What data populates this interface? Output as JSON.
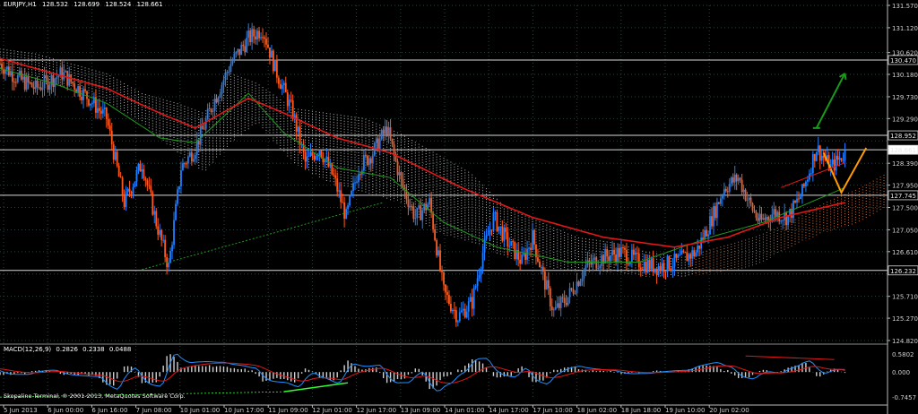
{
  "header": {
    "symbol": "EURJPY,H1",
    "open": "128.532",
    "high": "128.699",
    "low": "128.524",
    "close": "128.661"
  },
  "macd_header": {
    "name": "MACD(12,26,9)",
    "main": "0.2826",
    "signal": "0.2338",
    "histogram": "0.0488"
  },
  "copyright": "Skopalino Terminal, © 2001-2013, MetaQuotes Software Corp.",
  "colors": {
    "background": "#000000",
    "grid": "#2f3f3f",
    "bull": "#1e7fff",
    "bear": "#ff5a1e",
    "ma_red": "#e01818",
    "ma_green": "#1f9a1f",
    "cloud_bear": "#e8e8e8",
    "cloud_bull": "#ff9050",
    "orange_arrow": "#ff9a00",
    "green_arrow": "#1a9a1a",
    "macd_line": "#1e90ff",
    "signal_line": "#e01818",
    "hist": "#cfcfcf"
  },
  "chart_data": {
    "type": "candlestick",
    "symbol": "EURJPY",
    "timeframe": "H1",
    "ylim": [
      124.82,
      131.57
    ],
    "price_axis_ticks": [
      "131.570",
      "131.120",
      "130.620",
      "130.180",
      "129.730",
      "129.290",
      "128.840",
      "128.390",
      "127.950",
      "127.500",
      "127.050",
      "126.610",
      "126.160",
      "125.710",
      "125.270",
      "124.820"
    ],
    "horizontal_levels": [
      {
        "value": 130.47,
        "label": "130.470"
      },
      {
        "value": 128.952,
        "label": "128.952"
      },
      {
        "value": 128.661,
        "label": "128.661",
        "current": true
      },
      {
        "value": 127.745,
        "label": "127.745"
      },
      {
        "value": 126.232,
        "label": "126.232"
      }
    ],
    "time_axis_labels": [
      "5 Jun 2013",
      "6 Jun 00:00",
      "6 Jun 16:00",
      "7 Jun 08:00",
      "10 Jun 01:00",
      "10 Jun 17:00",
      "11 Jun 09:00",
      "12 Jun 01:00",
      "12 Jun 17:00",
      "13 Jun 09:00",
      "14 Jun 01:00",
      "14 Jun 17:00",
      "17 Jun 10:00",
      "18 Jun 02:00",
      "18 Jun 18:00",
      "19 Jun 10:00",
      "20 Jun 02:00"
    ],
    "close_path": [
      [
        0,
        130.4
      ],
      [
        10,
        130.1
      ],
      [
        20,
        129.9
      ],
      [
        35,
        130.2
      ],
      [
        50,
        129.7
      ],
      [
        60,
        129.3
      ],
      [
        70,
        127.6
      ],
      [
        80,
        128.4
      ],
      [
        88,
        127.2
      ],
      [
        95,
        126.3
      ],
      [
        102,
        128.3
      ],
      [
        110,
        128.7
      ],
      [
        120,
        129.6
      ],
      [
        130,
        130.4
      ],
      [
        140,
        130.9
      ],
      [
        148,
        131.1
      ],
      [
        155,
        130.3
      ],
      [
        165,
        129.4
      ],
      [
        172,
        128.4
      ],
      [
        180,
        128.7
      ],
      [
        188,
        128.1
      ],
      [
        195,
        127.3
      ],
      [
        202,
        128.3
      ],
      [
        210,
        128.6
      ],
      [
        218,
        129.1
      ],
      [
        226,
        128.0
      ],
      [
        234,
        127.3
      ],
      [
        242,
        127.6
      ],
      [
        250,
        125.8
      ],
      [
        258,
        125.3
      ],
      [
        266,
        125.6
      ],
      [
        272,
        126.6
      ],
      [
        278,
        127.3
      ],
      [
        286,
        126.8
      ],
      [
        294,
        126.4
      ],
      [
        300,
        126.9
      ],
      [
        306,
        126.1
      ],
      [
        312,
        125.4
      ],
      [
        320,
        125.7
      ],
      [
        330,
        126.3
      ],
      [
        340,
        126.5
      ],
      [
        350,
        126.6
      ],
      [
        360,
        126.4
      ],
      [
        370,
        126.3
      ],
      [
        380,
        126.4
      ],
      [
        392,
        126.6
      ],
      [
        400,
        127.2
      ],
      [
        408,
        127.9
      ],
      [
        416,
        128.1
      ],
      [
        422,
        127.6
      ],
      [
        428,
        127.2
      ],
      [
        436,
        127.4
      ],
      [
        444,
        127.3
      ],
      [
        452,
        127.8
      ],
      [
        460,
        128.7
      ],
      [
        468,
        128.3
      ],
      [
        476,
        128.6
      ]
    ],
    "close_path_units": "x = bar index, y = price",
    "ma_red": [
      [
        0,
        130.5
      ],
      [
        30,
        130.2
      ],
      [
        60,
        129.9
      ],
      [
        90,
        129.4
      ],
      [
        110,
        129.1
      ],
      [
        140,
        129.7
      ],
      [
        160,
        129.4
      ],
      [
        190,
        128.9
      ],
      [
        220,
        128.6
      ],
      [
        260,
        127.9
      ],
      [
        300,
        127.3
      ],
      [
        340,
        126.9
      ],
      [
        380,
        126.7
      ],
      [
        410,
        126.9
      ],
      [
        440,
        127.3
      ],
      [
        476,
        127.6
      ]
    ],
    "ma_green": [
      [
        0,
        130.3
      ],
      [
        30,
        130.0
      ],
      [
        60,
        129.6
      ],
      [
        90,
        128.9
      ],
      [
        110,
        128.8
      ],
      [
        140,
        129.8
      ],
      [
        160,
        129.0
      ],
      [
        190,
        128.3
      ],
      [
        220,
        128.1
      ],
      [
        250,
        127.2
      ],
      [
        280,
        126.7
      ],
      [
        320,
        126.4
      ],
      [
        360,
        126.4
      ],
      [
        400,
        126.9
      ],
      [
        430,
        127.2
      ],
      [
        476,
        127.9
      ]
    ],
    "cloud": [
      [
        0,
        130.7,
        130.2
      ],
      [
        20,
        130.6,
        130.0
      ],
      [
        40,
        130.4,
        129.9
      ],
      [
        60,
        130.2,
        129.6
      ],
      [
        80,
        129.8,
        129.2
      ],
      [
        100,
        129.6,
        128.6
      ],
      [
        115,
        129.4,
        128.2
      ],
      [
        130,
        130.2,
        128.8
      ],
      [
        145,
        130.0,
        129.2
      ],
      [
        165,
        129.5,
        128.4
      ],
      [
        185,
        129.4,
        128.0
      ],
      [
        205,
        129.3,
        127.8
      ],
      [
        225,
        129.0,
        127.6
      ],
      [
        245,
        128.6,
        127.0
      ],
      [
        265,
        128.2,
        126.8
      ],
      [
        285,
        127.5,
        126.5
      ],
      [
        305,
        127.2,
        126.3
      ],
      [
        325,
        126.9,
        126.2
      ],
      [
        345,
        126.8,
        126.2
      ],
      [
        365,
        126.6,
        126.1
      ],
      [
        385,
        126.5,
        126.1
      ],
      [
        405,
        126.7,
        126.2
      ],
      [
        425,
        126.9,
        126.3
      ],
      [
        445,
        127.2,
        126.7
      ],
      [
        465,
        127.6,
        127.0
      ],
      [
        485,
        127.9,
        127.2
      ],
      [
        500,
        128.2,
        127.5
      ]
    ],
    "annotations": [
      {
        "type": "arrow-up",
        "color": "green",
        "from": [
          460,
          129.1
        ],
        "to": [
          476,
          130.2
        ]
      },
      {
        "type": "v-shape",
        "color": "orange",
        "points": [
          [
            464,
            128.6
          ],
          [
            474,
            127.8
          ],
          [
            488,
            128.7
          ]
        ]
      },
      {
        "type": "trendline",
        "color": "green-dotted",
        "from": [
          80,
          126.25
        ],
        "to": [
          216,
          127.6
        ]
      },
      {
        "type": "trendline",
        "color": "red",
        "from": [
          440,
          127.9
        ],
        "to": [
          476,
          128.4
        ]
      }
    ],
    "macd": {
      "name": "MACD(12,26,9)",
      "main": 0.2826,
      "signal": 0.2338,
      "histogram": 0.0488,
      "ylim": [
        -0.7457,
        0.5802
      ],
      "axis_ticks": [
        "0.5802",
        "0.000",
        "-0.7457"
      ]
    }
  }
}
